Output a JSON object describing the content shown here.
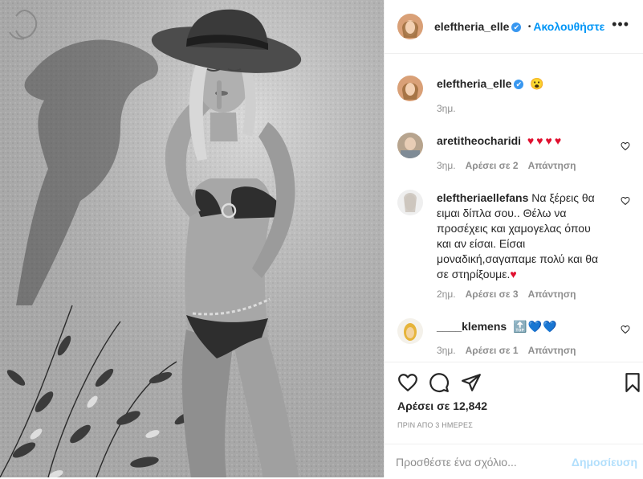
{
  "header": {
    "username": "eleftheria_elle",
    "verified_mark": "✔",
    "separator": "•",
    "follow_label": "Ακολουθήστε",
    "more_label": "•••"
  },
  "caption": {
    "username": "eleftheria_elle",
    "verified_mark": "✔",
    "text": "😮",
    "time": "3ημ."
  },
  "comments": [
    {
      "username": "aretitheocharidi",
      "text": "♥♥♥♥",
      "time": "3ημ.",
      "likes": "Αρέσει σε 2",
      "reply": "Απάντηση"
    },
    {
      "username": "eleftheriaellefans",
      "text_lines": [
        "Να ξέρεις θα",
        "ειμαι δίπλα σου.. Θέλω να",
        "προσέχεις και χαμογελας όπου",
        "και αν είσαι. Είσαι",
        "μοναδική,σαγαπαμε πολύ και θα",
        "σε στηρίξουμε."
      ],
      "heart": "♥",
      "time": "2ημ.",
      "likes": "Αρέσει σε 3",
      "reply": "Απάντηση"
    },
    {
      "username": "____klemens",
      "text": "🔝💙💙",
      "time": "3ημ.",
      "likes": "Αρέσει σε 1",
      "reply": "Απάντηση"
    }
  ],
  "actions": {
    "like_icon": "heart-outline-icon",
    "comment_icon": "comment-bubble-icon",
    "share_icon": "paper-plane-icon",
    "save_icon": "bookmark-icon",
    "likes_text": "Αρέσει σε 12,842",
    "time_text": "ΠΡΙΝ ΑΠΟ 3 ΗΜΕΡΕΣ"
  },
  "add_comment": {
    "placeholder": "Προσθέστε ένα σχόλιο...",
    "post_label": "Δημοσίευση"
  },
  "colors": {
    "link_blue": "#0095f6",
    "post_disabled": "#b2dffc",
    "muted": "#8e8e8e",
    "text": "#262626",
    "heart_red": "#e0102f",
    "verified_blue": "#3897f0"
  }
}
